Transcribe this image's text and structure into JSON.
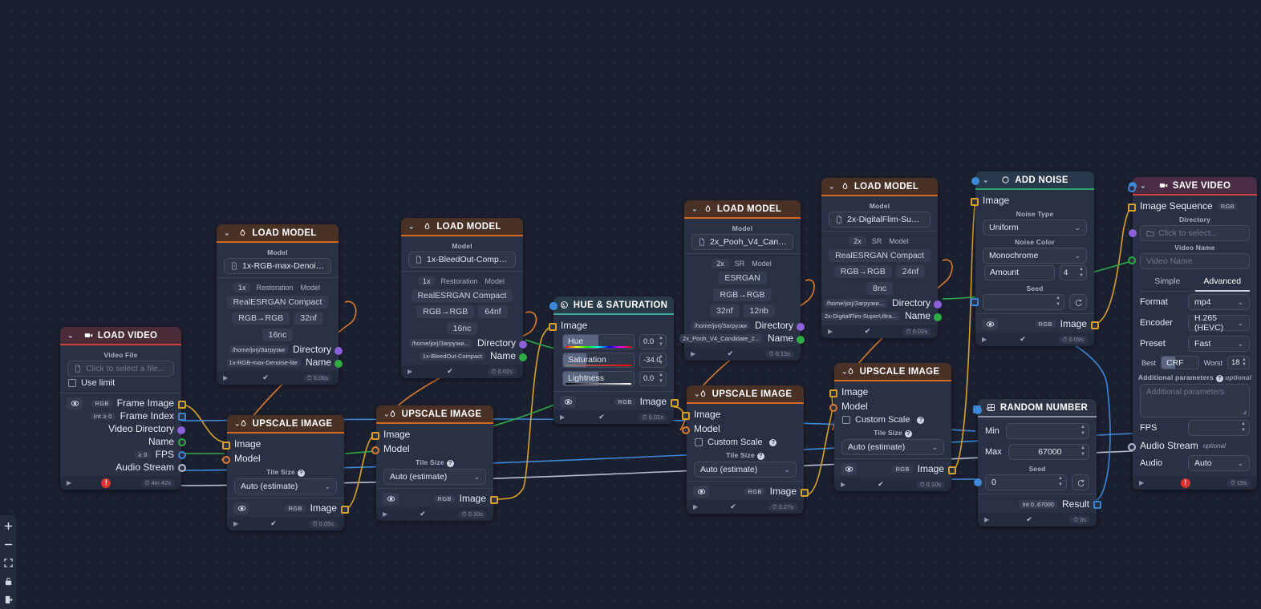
{
  "app": {
    "background": "#1b2030",
    "dot_color": "#2c3346"
  },
  "toolbar": {
    "items": [
      {
        "name": "zoom-in-icon",
        "label": "+"
      },
      {
        "name": "zoom-out-icon",
        "label": "−"
      },
      {
        "name": "fit-view-icon",
        "label": "fit"
      },
      {
        "name": "lock-icon",
        "label": "lock"
      },
      {
        "name": "export-icon",
        "label": "export"
      }
    ]
  },
  "nodes": {
    "load_video": {
      "title": "LOAD VIDEO",
      "accent": "#d04040",
      "header_bg": "#4a2c38",
      "icon": "video-icon",
      "video_file_label": "Video File",
      "video_file_placeholder": "Click to select a file...",
      "use_limit_label": "Use limit",
      "outputs": [
        {
          "label": "Frame Image",
          "type": "RGB",
          "handle": "square-yellow"
        },
        {
          "label": "Frame Index",
          "type": "Int ≥ 0",
          "handle": "square-blue"
        },
        {
          "label": "Video Directory",
          "type": "",
          "handle": "dot-purple"
        },
        {
          "label": "Name",
          "type": "",
          "handle": "circle-green"
        },
        {
          "label": "FPS",
          "type": "≥ 0",
          "handle": "circle-blue"
        },
        {
          "label": "Audio Stream",
          "type": "",
          "handle": "circle-grey"
        }
      ],
      "footer_time": "4m 42s",
      "footer_error": "!"
    },
    "load_model_1": {
      "title": "LOAD MODEL",
      "accent": "#d2691e",
      "header_bg": "#4a3126",
      "icon": "drop-icon",
      "model_label": "Model",
      "model_value": "1x-RGB-max-Denoise-lite....",
      "tags_row1": [
        "1x",
        "Restoration",
        "Model"
      ],
      "arch": "RealESRGAN Compact",
      "tags_row2": [
        "RGB→RGB",
        "32nf",
        "16nc"
      ],
      "directory_value": "/home/jorj/Загрузки",
      "directory_label": "Directory",
      "name_value": "1x-RGB-max-Denoise-lite",
      "name_label": "Name",
      "footer_time": "0.06s"
    },
    "load_model_2": {
      "title": "LOAD MODEL",
      "accent": "#d2691e",
      "header_bg": "#4a3126",
      "icon": "drop-icon",
      "model_label": "Model",
      "model_value": "1x-BleedOut-Compact.pth",
      "tags_row1": [
        "1x",
        "Restoration",
        "Model"
      ],
      "arch": "RealESRGAN Compact",
      "tags_row2": [
        "RGB→RGB",
        "64nf",
        "16nc"
      ],
      "directory_value": "/home/jorj/Загрузки...",
      "directory_label": "Directory",
      "name_value": "1x-BleedOut-Compact",
      "name_label": "Name",
      "footer_time": "0.02s"
    },
    "load_model_3": {
      "title": "LOAD MODEL",
      "accent": "#d2691e",
      "header_bg": "#4a3126",
      "icon": "drop-icon",
      "model_label": "Model",
      "model_value": "2x_Pooh_V4_Candidate_2...",
      "tags_row1": [
        "2x",
        "SR",
        "Model"
      ],
      "tags_arch": [
        "ESRGAN",
        "RGB→RGB"
      ],
      "tags_row2": [
        "32nf",
        "12nb"
      ],
      "directory_value": "/home/jorj/Загрузки",
      "directory_label": "Directory",
      "name_value": "2x_Pooh_V4_Candidate_2...",
      "name_label": "Name",
      "footer_time": "0.13s"
    },
    "load_model_4": {
      "title": "LOAD MODEL",
      "accent": "#d2691e",
      "header_bg": "#4a3126",
      "icon": "drop-icon",
      "model_label": "Model",
      "model_value": "2x-DigitalFlim-SuperUltra...",
      "tags_row1": [
        "2x",
        "SR",
        "Model"
      ],
      "arch": "RealESRGAN Compact",
      "tags_row2": [
        "RGB→RGB",
        "24nf",
        "8nc"
      ],
      "directory_value": "/home/jorj/Загрузки...",
      "directory_label": "Directory",
      "name_value": "2x-DigitalFlim-SuperUltra...",
      "name_label": "Name",
      "footer_time": "0.02s"
    },
    "upscale_1": {
      "title": "UPSCALE IMAGE",
      "accent": "#d2691e",
      "header_bg": "#4a3126",
      "icon": "drop-icon",
      "input_image": "Image",
      "input_model": "Model",
      "tile_label": "Tile Size",
      "tile_value": "Auto (estimate)",
      "output_label": "Image",
      "output_type": "RGB",
      "footer_time": "0.05s"
    },
    "upscale_2": {
      "title": "UPSCALE IMAGE",
      "accent": "#d2691e",
      "header_bg": "#4a3126",
      "icon": "drop-icon",
      "input_image": "Image",
      "input_model": "Model",
      "tile_label": "Tile Size",
      "tile_value": "Auto (estimate)",
      "output_label": "Image",
      "output_type": "RGB",
      "footer_time": "0.10s"
    },
    "upscale_3": {
      "title": "UPSCALE IMAGE",
      "accent": "#d2691e",
      "header_bg": "#4a3126",
      "icon": "drop-icon",
      "input_image": "Image",
      "input_model": "Model",
      "custom_scale_label": "Custom Scale",
      "tile_label": "Tile Size",
      "tile_value": "Auto (estimate)",
      "output_label": "Image",
      "output_type": "RGB",
      "footer_time": "0.27s"
    },
    "upscale_4": {
      "title": "UPSCALE IMAGE",
      "accent": "#d2691e",
      "header_bg": "#4a3126",
      "icon": "drop-icon",
      "input_image": "Image",
      "input_model": "Model",
      "custom_scale_label": "Custom Scale",
      "tile_label": "Tile Size",
      "tile_value": "Auto (estimate)",
      "output_label": "Image",
      "output_type": "RGB",
      "footer_time": "0.10s"
    },
    "hue_saturation": {
      "title": "HUE & SATURATION",
      "accent": "#3aa8a0",
      "header_bg": "#2a3b48",
      "icon": "palette-icon",
      "input_image": "Image",
      "sliders": [
        {
          "label": "Hue",
          "value": "0.0",
          "fill_pct": 50,
          "bar": "hue"
        },
        {
          "label": "Saturation",
          "value": "-34.0",
          "fill_pct": 33,
          "bar": "sat"
        },
        {
          "label": "Lightness",
          "value": "0.0",
          "fill_pct": 50,
          "bar": "light"
        }
      ],
      "output_label": "Image",
      "output_type": "RGB",
      "footer_time": "0.01s"
    },
    "add_noise": {
      "title": "ADD NOISE",
      "accent": "#2fa96b",
      "header_bg": "#27394a",
      "icon": "circle-icon",
      "input_image": "Image",
      "noise_type_label": "Noise Type",
      "noise_type_value": "Uniform",
      "noise_color_label": "Noise Color",
      "noise_color_value": "Monochrome",
      "amount_label": "Amount",
      "amount_value": "4",
      "seed_label": "Seed",
      "seed_value": "",
      "output_label": "Image",
      "output_type": "RGB",
      "footer_time": "0.09s"
    },
    "random_number": {
      "title": "RANDOM NUMBER",
      "accent": "#8a93a8",
      "header_bg": "#2c3446",
      "icon": "grid-icon",
      "min_label": "Min",
      "min_value": "",
      "max_label": "Max",
      "max_value": "67000",
      "seed_label": "Seed",
      "seed_value": "0",
      "result_label": "Result",
      "result_type": "Int 0..67000",
      "footer_time": "0s"
    },
    "save_video": {
      "title": "SAVE VIDEO",
      "accent": "#d04040",
      "header_bg": "#4a2c44",
      "icon": "video-icon",
      "image_sequence_label": "Image Sequence",
      "image_sequence_type": "RGB",
      "directory_label": "Directory",
      "directory_placeholder": "Click to select...",
      "video_name_label": "Video Name",
      "video_name_placeholder": "Video Name",
      "tabs": [
        {
          "label": "Simple",
          "active": false
        },
        {
          "label": "Advanced",
          "active": true
        }
      ],
      "format_label": "Format",
      "format_value": "mp4",
      "encoder_label": "Encoder",
      "encoder_value": "H.265 (HEVC)",
      "preset_label": "Preset",
      "preset_value": "Fast",
      "crf_best": "Best",
      "crf_label": "CRF",
      "crf_worst": "Worst",
      "crf_value": "18",
      "additional_label": "Additional parameters",
      "additional_optional": "optional",
      "additional_placeholder": "Additional parameters",
      "fps_label": "FPS",
      "fps_value": "",
      "audio_stream_label": "Audio Stream",
      "audio_stream_optional": "optional",
      "audio_label": "Audio",
      "audio_value": "Auto",
      "footer_time": "19s",
      "footer_error": "!"
    }
  },
  "edge_colors": {
    "image": "#d9a227",
    "model": "#e07a2a",
    "number": "#3d88d8",
    "text": "#2faa44",
    "audio": "#b7bfd0",
    "directory": "#8b61d9"
  }
}
